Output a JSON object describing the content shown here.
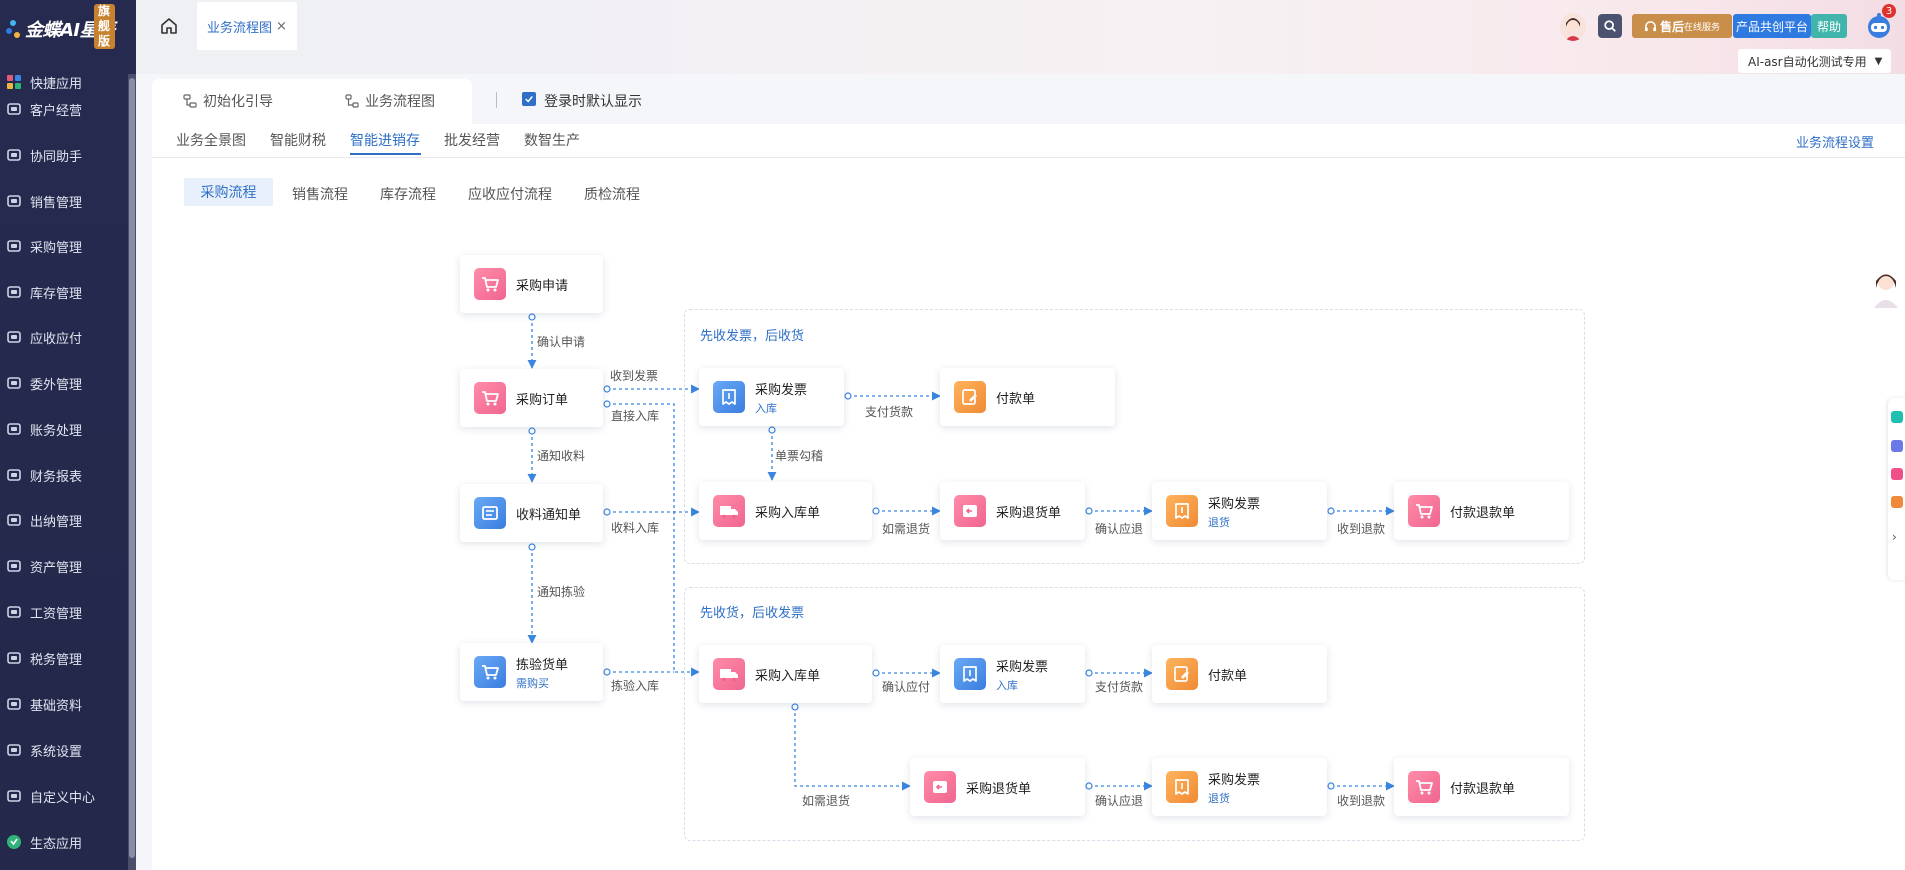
{
  "app": {
    "logo_text": "金蝶AI星辰",
    "logo_badge": "旗舰版"
  },
  "sidebar": {
    "items": [
      {
        "label": "快捷应用",
        "icon": "grid-apps-icon"
      },
      {
        "label": "客户经营",
        "icon": "user-icon"
      },
      {
        "label": "协同助手",
        "icon": "contact-card-icon"
      },
      {
        "label": "销售管理",
        "icon": "sales-chart-icon"
      },
      {
        "label": "采购管理",
        "icon": "cart-icon"
      },
      {
        "label": "库存管理",
        "icon": "box-icon"
      },
      {
        "label": "应收应付",
        "icon": "coin-icon"
      },
      {
        "label": "委外管理",
        "icon": "outsource-icon"
      },
      {
        "label": "账务处理",
        "icon": "ledger-icon"
      },
      {
        "label": "财务报表",
        "icon": "report-icon"
      },
      {
        "label": "出纳管理",
        "icon": "cashier-icon"
      },
      {
        "label": "资产管理",
        "icon": "asset-icon"
      },
      {
        "label": "工资管理",
        "icon": "salary-icon"
      },
      {
        "label": "税务管理",
        "icon": "tax-icon"
      },
      {
        "label": "基础资料",
        "icon": "layers-icon"
      },
      {
        "label": "系统设置",
        "icon": "settings-icon"
      },
      {
        "label": "自定义中心",
        "icon": "tools-icon"
      },
      {
        "label": "生态应用",
        "icon": "eco-app-icon"
      }
    ]
  },
  "header": {
    "open_tab": "业务流程图",
    "service_btn": "售后",
    "service_btn_small": "在线服务",
    "platform_btn": "产品共创平台",
    "help_btn": "帮助",
    "notification_count": "3",
    "org_select": "AI-asr自动化测试专用"
  },
  "top_tabs": [
    {
      "label": "初始化引导"
    },
    {
      "label": "业务流程图"
    }
  ],
  "login_default": {
    "label": "登录时默认显示",
    "checked": true
  },
  "sub_tabs": [
    {
      "label": "业务全景图"
    },
    {
      "label": "智能财税"
    },
    {
      "label": "智能进销存",
      "active": true
    },
    {
      "label": "批发经营"
    },
    {
      "label": "数智生产"
    }
  ],
  "settings_link": "业务流程设置",
  "flow_tabs": [
    {
      "label": "采购流程",
      "active": true
    },
    {
      "label": "销售流程"
    },
    {
      "label": "库存流程"
    },
    {
      "label": "应收应付流程"
    },
    {
      "label": "质检流程"
    }
  ],
  "groups": {
    "g1_title": "先收发票，后收货",
    "g2_title": "先收货，后收发票"
  },
  "nodes": {
    "purchase_request": {
      "title": "采购申请"
    },
    "purchase_order": {
      "title": "采购订单"
    },
    "receipt_notice": {
      "title": "收料通知单"
    },
    "inspection_order": {
      "title": "拣验货单",
      "sub": "需购买"
    },
    "g1_invoice": {
      "title": "采购发票",
      "sub": "入库"
    },
    "g1_payment": {
      "title": "付款单"
    },
    "g1_instock": {
      "title": "采购入库单"
    },
    "g1_return": {
      "title": "采购退货单"
    },
    "g1_return_invoice": {
      "title": "采购发票",
      "sub": "退货"
    },
    "g1_refund": {
      "title": "付款退款单"
    },
    "g2_instock": {
      "title": "采购入库单"
    },
    "g2_invoice": {
      "title": "采购发票",
      "sub": "入库"
    },
    "g2_payment": {
      "title": "付款单"
    },
    "g2_return": {
      "title": "采购退货单"
    },
    "g2_return_invoice": {
      "title": "采购发票",
      "sub": "退货"
    },
    "g2_refund": {
      "title": "付款退款单"
    }
  },
  "edges": {
    "confirm_request": "确认申请",
    "receive_invoice": "收到发票",
    "direct_instock": "直接入库",
    "notify_receive": "通知收料",
    "receive_instock": "收料入库",
    "notify_inspect": "通知拣验",
    "inspect_instock": "拣验入库",
    "pay_goods_1": "支付货款",
    "invoice_match": "单票勾稽",
    "if_return_1": "如需退货",
    "confirm_refund_1": "确认应退",
    "receive_refund_1": "收到退款",
    "confirm_payable": "确认应付",
    "pay_goods_2": "支付货款",
    "if_return_2": "如需退货",
    "confirm_refund_2": "确认应退",
    "receive_refund_2": "收到退款"
  },
  "colors": {
    "sidebar_bg": "#262a4f",
    "accent": "#2f6fc6",
    "icon_pink": "#f06590",
    "icon_blue": "#3a7de0",
    "icon_orange": "#f08a35"
  }
}
